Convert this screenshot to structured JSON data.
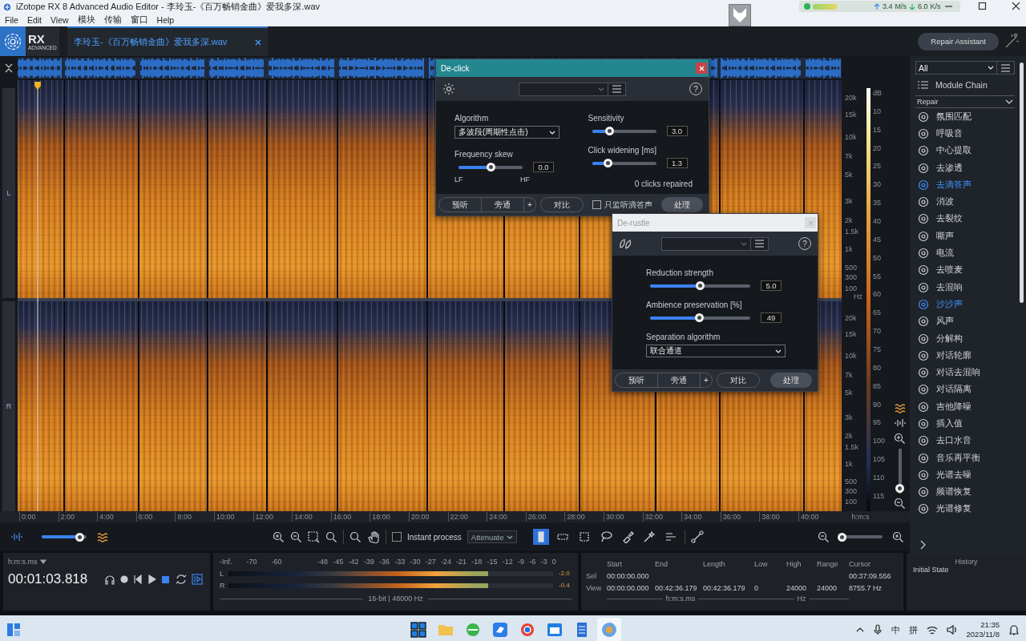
{
  "window": {
    "title": "iZotope RX 8 Advanced Audio Editor - 李玲玉-《百万畅销金曲》爱我多深.wav"
  },
  "network_monitor": {
    "upload": "3.4",
    "upload_unit": "M/s",
    "download": "6.0",
    "download_unit": "K/s"
  },
  "menu": [
    "File",
    "Edit",
    "View",
    "模块",
    "传输",
    "窗口",
    "Help"
  ],
  "logo": {
    "text": "RX",
    "subtitle": "ADVANCED"
  },
  "file_tabs": [
    {
      "label": "李玲玉-《百万畅销金曲》爱我多深.wav",
      "selected": true
    }
  ],
  "repair_assistant": "Repair Assistant",
  "editor": {
    "channels": [
      "L",
      "R"
    ],
    "freq_ticks": [
      [
        "20k",
        "15k",
        "10k",
        "7k",
        "5k",
        "3k",
        "2k",
        "1.5k",
        "1k",
        "500",
        "300",
        "100"
      ],
      [
        "20k",
        "15k",
        "10k",
        "7k",
        "5k",
        "3k",
        "2k",
        "1.5k",
        "1k",
        "500",
        "300",
        "100"
      ]
    ],
    "freq_unit": "Hz",
    "db_unit": "dB",
    "db_ticks": [
      "10",
      "15",
      "20",
      "25",
      "30",
      "35",
      "40",
      "45",
      "50",
      "55",
      "60",
      "65",
      "70",
      "75",
      "80",
      "85",
      "90",
      "95",
      "100",
      "105",
      "110",
      "115"
    ],
    "time_ticks": [
      "0:00",
      "2:00",
      "4:00",
      "6:00",
      "8:00",
      "10:00",
      "12:00",
      "14:00",
      "16:00",
      "18:00",
      "20:00",
      "22:00",
      "24:00",
      "26:00",
      "28:00",
      "30:00",
      "32:00",
      "34:00",
      "36:00",
      "38:00",
      "40:00"
    ],
    "time_unit": "h:m:s",
    "freq_zoom": {
      "level": 0.02
    }
  },
  "toolbar": {
    "waveform_blend": {
      "level": 0.86
    },
    "instant_process": {
      "label": "Instant process",
      "checked": false
    },
    "mode": "Attenuate",
    "tools": [
      {
        "kind": "time",
        "selected": true
      },
      {
        "kind": "frequency",
        "selected": false
      },
      {
        "kind": "timefreq",
        "selected": false
      },
      {
        "kind": "lasso",
        "selected": false
      },
      {
        "kind": "brush",
        "selected": false
      },
      {
        "kind": "wand",
        "selected": false
      },
      {
        "kind": "harmonic",
        "selected": false
      }
    ],
    "zoom": {
      "level": 0.05
    }
  },
  "sidebar": {
    "filter": "All",
    "module_chain": "Module Chain",
    "category": "Repair",
    "modules": [
      {
        "label": "氛围匹配",
        "selected": false
      },
      {
        "label": "呼吸音",
        "selected": false
      },
      {
        "label": "中心提取",
        "selected": false
      },
      {
        "label": "去渗透",
        "selected": false
      },
      {
        "label": "去滴答声",
        "selected": true
      },
      {
        "label": "消波",
        "selected": false
      },
      {
        "label": "去裂纹",
        "selected": false
      },
      {
        "label": "嘶声",
        "selected": false
      },
      {
        "label": "电流",
        "selected": false
      },
      {
        "label": "去喷麦",
        "selected": false
      },
      {
        "label": "去混响",
        "selected": false
      },
      {
        "label": "沙沙声",
        "selected": true
      },
      {
        "label": "风声",
        "selected": false
      },
      {
        "label": "分解构",
        "selected": false
      },
      {
        "label": "对话轮廓",
        "selected": false
      },
      {
        "label": "对话去混响",
        "selected": false
      },
      {
        "label": "对话隔离",
        "selected": false
      },
      {
        "label": "吉他降噪",
        "selected": false
      },
      {
        "label": "插入值",
        "selected": false
      },
      {
        "label": "去口水音",
        "selected": false
      },
      {
        "label": "音乐再平衡",
        "selected": false
      },
      {
        "label": "光谱去噪",
        "selected": false
      },
      {
        "label": "频谱恢复",
        "selected": false
      },
      {
        "label": "光谱修复",
        "selected": false
      }
    ]
  },
  "dialogs": [
    {
      "kind": "declick",
      "title": "De-click",
      "active": true,
      "help": "?",
      "columns": [
        [
          {
            "kind": "dropdown",
            "label": "Algorithm",
            "value": "多波段(周期性点击)"
          },
          {
            "kind": "slider",
            "label": "Frequency skew",
            "level": 0.5,
            "value": "0.0",
            "min_label": "LF",
            "max_label": "HF"
          }
        ],
        [
          {
            "kind": "slider",
            "label": "Sensitivity",
            "level": 0.27,
            "value": "3.0"
          },
          {
            "kind": "slider",
            "label": "Click widening [ms]",
            "level": 0.25,
            "value": "1.3"
          },
          {
            "kind": "status",
            "text": "0 clicks repaired"
          }
        ]
      ],
      "footer": {
        "preview": "预听",
        "bypass": "旁通",
        "add": "+",
        "compare": "对比",
        "process": "处理",
        "checkbox": {
          "label": "只监听滴答声",
          "checked": false
        }
      }
    },
    {
      "kind": "derustle",
      "title": "De-rustle",
      "active": false,
      "help": "?",
      "columns": [
        [
          {
            "kind": "slider",
            "label": "Reduction strength",
            "level": 0.5,
            "value": "5.0"
          },
          {
            "kind": "slider",
            "label": "Ambience preservation [%]",
            "level": 0.49,
            "value": "49"
          },
          {
            "kind": "dropdown",
            "label": "Separation algorithm",
            "value": "联合通道"
          }
        ]
      ],
      "footer": {
        "preview": "预听",
        "bypass": "旁通",
        "add": "+",
        "compare": "对比",
        "process": "处理"
      }
    }
  ],
  "transport": {
    "time_format": "h:m:s.ms",
    "time": "00:01:03.818"
  },
  "meters": {
    "scale": [
      "-Inf.",
      "-70",
      "-60",
      "-48",
      "-45",
      "-42",
      "-39",
      "-36",
      "-33",
      "-30",
      "-27",
      "-24",
      "-21",
      "-18",
      "-15",
      "-12",
      "-9",
      "-6",
      "-3",
      "0"
    ],
    "channels": [
      {
        "label": "L",
        "level": 0.8,
        "peak": "-2.0"
      },
      {
        "label": "R",
        "level": 0.8,
        "peak": "-0.4"
      }
    ],
    "format": "16-bit | 48000 Hz"
  },
  "selection_info": {
    "columns": [
      "Start",
      "End",
      "Length"
    ],
    "rows": [
      {
        "label": "Sel",
        "values": [
          "00:00:00.000"
        ]
      },
      {
        "label": "View",
        "values": [
          "00:00:00.000",
          "00:42:36.179",
          "00:42:36.179"
        ]
      }
    ],
    "unit": "h:m:s.ms"
  },
  "frequency_info": {
    "columns": [
      "Low",
      "High",
      "Range"
    ],
    "values": [
      "0",
      "24000",
      "24000"
    ],
    "unit": "Hz"
  },
  "cursor": {
    "label": "Cursor",
    "time": "00:37:09.556",
    "frequency": "8755.7 Hz"
  },
  "history": {
    "title": "History",
    "items": [
      "Initial State"
    ]
  },
  "taskbar": {
    "apps": [
      {
        "kind": "windows",
        "selected": false
      },
      {
        "kind": "folder",
        "selected": false
      },
      {
        "kind": "globe",
        "selected": false
      },
      {
        "kind": "bird",
        "selected": false
      },
      {
        "kind": "ring",
        "selected": false
      },
      {
        "kind": "window",
        "selected": false
      },
      {
        "kind": "notepad",
        "selected": false
      },
      {
        "kind": "disc",
        "selected": true
      }
    ],
    "ime_mode": "中",
    "ime": "拼",
    "time": "21:35",
    "date": "2023/11/8"
  }
}
